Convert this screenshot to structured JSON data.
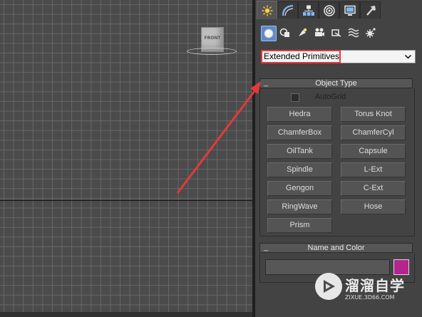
{
  "viewport": {
    "viewcube_label": "FRONT"
  },
  "command_panel": {
    "tabs": [
      {
        "icon": "create-icon",
        "active": true
      },
      {
        "icon": "modify-icon",
        "active": false
      },
      {
        "icon": "hierarchy-icon",
        "active": false
      },
      {
        "icon": "motion-icon",
        "active": false
      },
      {
        "icon": "display-icon",
        "active": false
      },
      {
        "icon": "utilities-icon",
        "active": false
      }
    ],
    "categories": [
      {
        "icon": "geometry-icon",
        "active": true
      },
      {
        "icon": "shapes-icon",
        "active": false
      },
      {
        "icon": "lights-icon",
        "active": false
      },
      {
        "icon": "cameras-icon",
        "active": false
      },
      {
        "icon": "helpers-icon",
        "active": false
      },
      {
        "icon": "space-warps-icon",
        "active": false
      },
      {
        "icon": "systems-icon",
        "active": false
      }
    ],
    "subcategory_dropdown": {
      "selected": "Extended Primitives"
    },
    "object_type": {
      "title": "Object Type",
      "collapse_symbol": "_",
      "autogrid_label": "AutoGrid",
      "autogrid_checked": false,
      "buttons": [
        "Hedra",
        "Torus Knot",
        "ChamferBox",
        "ChamferCyl",
        "OilTank",
        "Capsule",
        "Spindle",
        "L-Ext",
        "Gengon",
        "C-Ext",
        "RingWave",
        "Hose",
        "Prism"
      ]
    },
    "name_and_color": {
      "title": "Name and Color",
      "collapse_symbol": "_",
      "name_value": "",
      "color": "#b5248c"
    }
  },
  "colors": {
    "annotation_red": "#e23a3a",
    "active_blue": "#5e88c9"
  },
  "watermark": {
    "brand": "溜溜自学",
    "url": "ZIXUE.3D66.COM"
  }
}
